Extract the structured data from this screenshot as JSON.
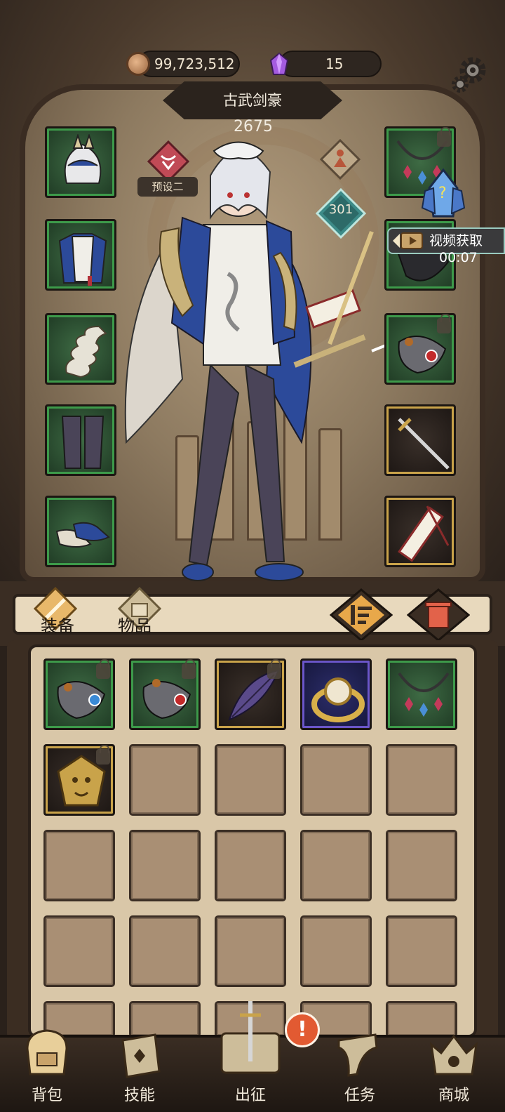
{
  "header": {
    "coins": "99,723,512",
    "gems": "15"
  },
  "character": {
    "class_name": "古武剑豪",
    "power": "2675",
    "preset": "预设二",
    "level": "301"
  },
  "video_reward": {
    "label": "视频获取",
    "timer": "00:07"
  },
  "bag": {
    "tabs": [
      {
        "label": "装备",
        "active": true
      },
      {
        "label": "物品",
        "active": false
      }
    ],
    "items": [
      {
        "name": "bracer-blue-gem-icon",
        "rarity": "green",
        "locked": true
      },
      {
        "name": "bracer-red-gem-icon",
        "rarity": "green",
        "locked": true
      },
      {
        "name": "purple-feather-icon",
        "rarity": "gold",
        "locked": true
      },
      {
        "name": "pearl-ring-icon",
        "rarity": "purple",
        "locked": false
      },
      {
        "name": "gem-necklace-icon",
        "rarity": "green",
        "locked": false
      },
      {
        "name": "lion-amulet-icon",
        "rarity": "gold",
        "locked": true
      }
    ]
  },
  "equipped_left": [
    {
      "name": "mask-helmet-icon",
      "rarity": "green"
    },
    {
      "name": "robe-armor-icon",
      "rarity": "green"
    },
    {
      "name": "bandage-wrap-icon",
      "rarity": "green"
    },
    {
      "name": "leggings-icon",
      "rarity": "green"
    },
    {
      "name": "shoes-icon",
      "rarity": "green"
    }
  ],
  "equipped_right": [
    {
      "name": "gem-necklace-icon",
      "rarity": "green",
      "locked": true
    },
    {
      "name": "black-cloak-icon",
      "rarity": "green",
      "locked": false
    },
    {
      "name": "bracer-red-gem-icon",
      "rarity": "green",
      "locked": true
    },
    {
      "name": "sword-icon",
      "rarity": "gold",
      "locked": false
    },
    {
      "name": "talisman-icon",
      "rarity": "gold",
      "locked": false
    }
  ],
  "bottom_nav": [
    {
      "label": "背包",
      "icon": "backpack-icon"
    },
    {
      "label": "技能",
      "icon": "skill-book-icon"
    },
    {
      "label": "出征",
      "icon": "sword-scroll-icon"
    },
    {
      "label": "任务",
      "icon": "quest-horn-icon"
    },
    {
      "label": "商城",
      "icon": "crown-shop-icon"
    }
  ],
  "alert": "!",
  "colors": {
    "rarity_green": "#3d9a4a",
    "rarity_gold": "#c9a34a",
    "rarity_purple": "#6b56c9",
    "alert": "#e25a32"
  }
}
